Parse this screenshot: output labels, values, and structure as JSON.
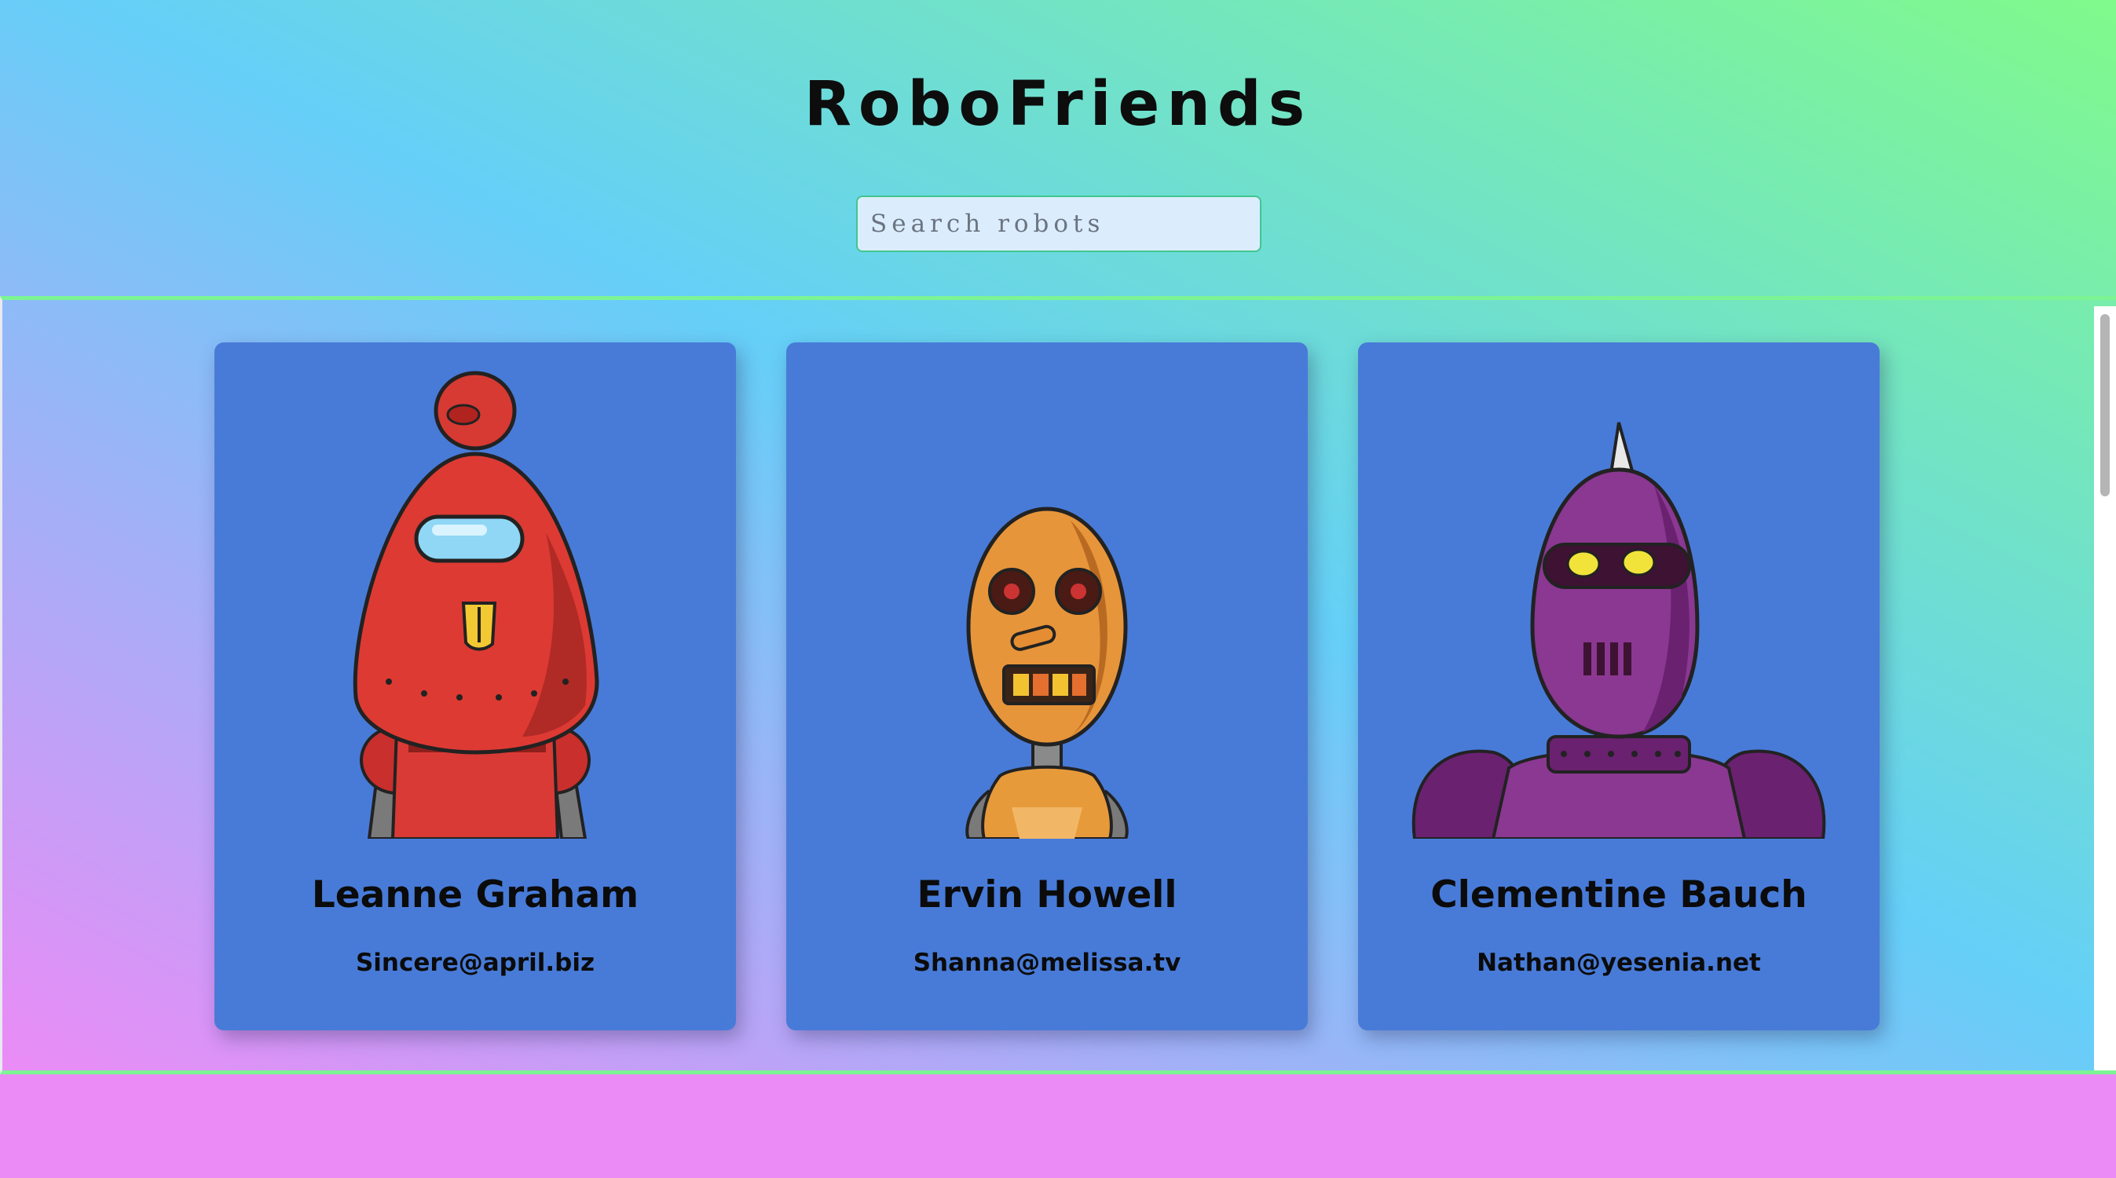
{
  "app": {
    "title": "RoboFriends"
  },
  "search": {
    "placeholder": "Search robots",
    "value": ""
  },
  "robots": [
    {
      "name": "Leanne Graham",
      "email": "Sincere@april.biz",
      "avatar_icon": "red-robot-icon"
    },
    {
      "name": "Ervin Howell",
      "email": "Shanna@melissa.tv",
      "avatar_icon": "orange-robot-icon"
    },
    {
      "name": "Clementine Bauch",
      "email": "Nathan@yesenia.net",
      "avatar_icon": "purple-robot-icon"
    }
  ],
  "colors": {
    "card_background": "#487bd8",
    "gradient_start": "#eb8bf6",
    "gradient_mid": "#65cff8",
    "gradient_end": "#80fa8b",
    "scroll_border": "#7cf494"
  }
}
